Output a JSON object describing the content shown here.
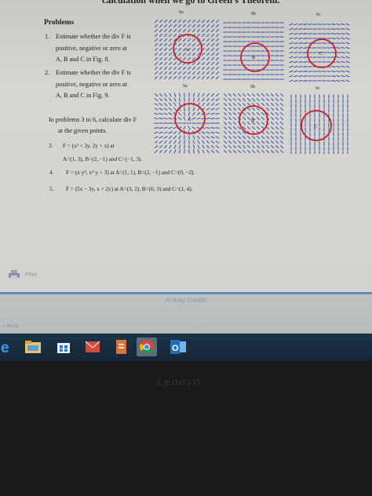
{
  "document": {
    "cut_heading": "calculation when we go to Green's Theorem.",
    "problems_title": "Problems",
    "problems": [
      {
        "number": "1.",
        "lines": [
          "Estimate whether the div F is",
          "positive, negative or zero at",
          "A, B and C in Fig. 8."
        ]
      },
      {
        "number": "2.",
        "lines": [
          "Estimate whether the div F is",
          "positive, negative or zero at",
          "A, B and C in Fig. 9."
        ]
      }
    ],
    "intro_lines": [
      "In problems 3 to 6, calculate div F",
      "at the given points."
    ],
    "p3_number": "3.",
    "p3_formula": "F = (x² + 3y, 2y + x) at",
    "p3_points": "A=(1, 3), B=(2, −1) and C=(−1, 3).",
    "p4_number": "4.",
    "p4_text": "F = (x·y², x³·y + 3) at A=(1, 1), B=(2, −1) and C=(0, −2).",
    "p5_number": "5.",
    "p5_text": "F = (5x − 3y, x + 2y) at A=(3, 2), B=(0, 3) and C=(1, 4).",
    "figures": {
      "fig8_labels": [
        "8a",
        "8b",
        "8c"
      ],
      "fig9_labels": [
        "9a",
        "9b",
        "9c"
      ],
      "point_labels": [
        "A",
        "B",
        "C"
      ]
    }
  },
  "print_label": "Print",
  "activity_details": "Activity Details",
  "side_label": "« More",
  "taskbar": {
    "items": [
      "internet-explorer-icon",
      "file-explorer-icon",
      "store-icon",
      "document-icon",
      "chrome-icon",
      "outlook-icon"
    ]
  },
  "bezel_brand": "Lenovo",
  "colors": {
    "accent": "#5b8fc6",
    "taskbar": "#1b3246",
    "circle": "#c8202a",
    "arrows": "#2b3aa8"
  }
}
